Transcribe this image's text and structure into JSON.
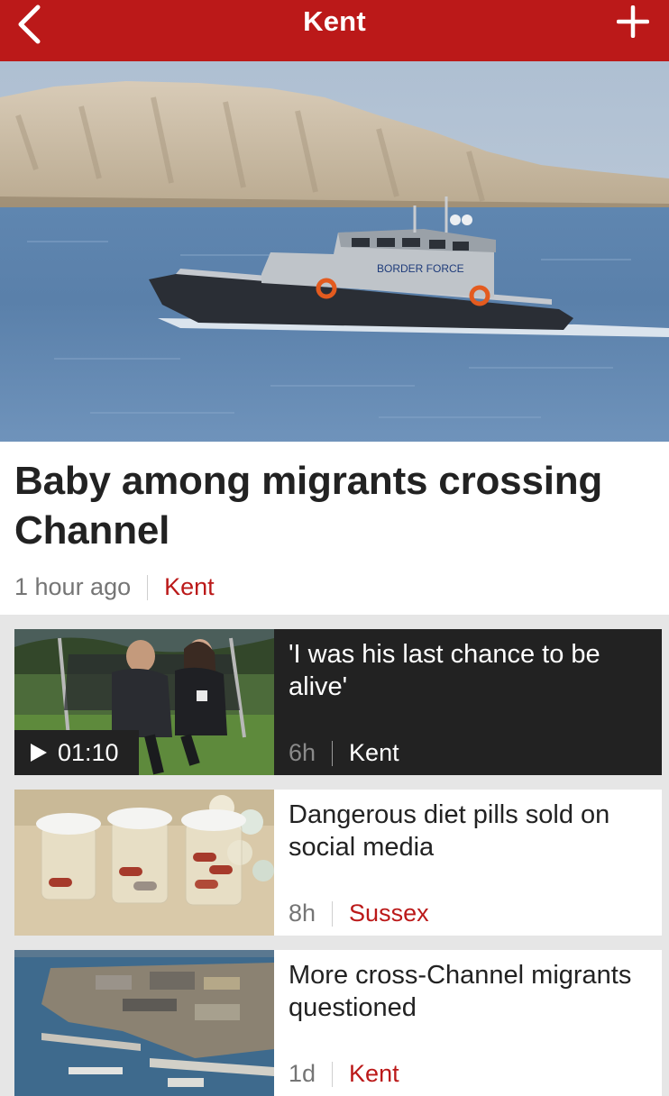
{
  "header": {
    "title": "Kent",
    "back_icon": "chevron-left-icon",
    "add_icon": "plus-icon"
  },
  "hero": {
    "image": "border-force-boat-photo",
    "boat_text": "BORDER FORCE"
  },
  "lead_story": {
    "headline": "Baby among migrants crossing Channel",
    "time": "1 hour ago",
    "section": "Kent"
  },
  "stories": [
    {
      "headline": "'I was his last chance to be alive'",
      "time": "6h",
      "section": "Kent",
      "video_duration": "01:10",
      "image": "couple-on-bench-photo"
    },
    {
      "headline": "Dangerous diet pills sold on social media",
      "time": "8h",
      "section": "Sussex",
      "image": "diet-pills-jars-photo"
    },
    {
      "headline": "More cross-Channel migrants questioned",
      "time": "1d",
      "section": "Kent",
      "image": "harbour-aerial-photo"
    }
  ],
  "colors": {
    "accent": "#bb1919",
    "dark_card": "#222222",
    "background": "#e6e6e6"
  }
}
